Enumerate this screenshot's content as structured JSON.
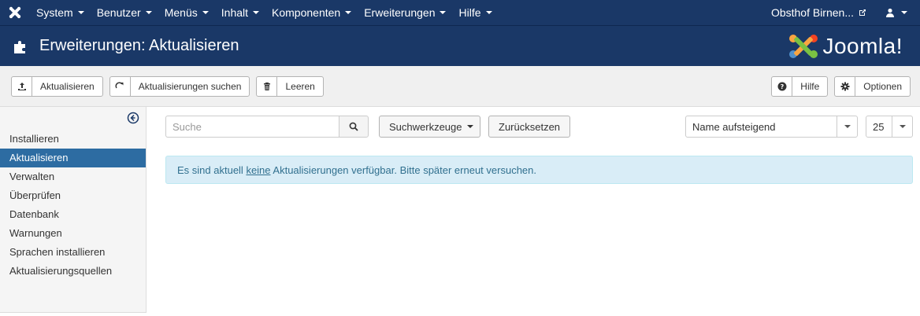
{
  "nav": {
    "items": [
      {
        "label": "System"
      },
      {
        "label": "Benutzer"
      },
      {
        "label": "Menüs"
      },
      {
        "label": "Inhalt"
      },
      {
        "label": "Komponenten"
      },
      {
        "label": "Erweiterungen"
      },
      {
        "label": "Hilfe"
      }
    ],
    "site_name": "Obsthof Birnen..."
  },
  "header": {
    "title": "Erweiterungen: Aktualisieren",
    "brand": "Joomla!"
  },
  "toolbar": {
    "update_label": "Aktualisieren",
    "find_updates_label": "Aktualisierungen suchen",
    "clear_label": "Leeren",
    "help_label": "Hilfe",
    "options_label": "Optionen"
  },
  "sidebar": {
    "items": [
      {
        "label": "Installieren"
      },
      {
        "label": "Aktualisieren",
        "active": true
      },
      {
        "label": "Verwalten"
      },
      {
        "label": "Überprüfen"
      },
      {
        "label": "Datenbank"
      },
      {
        "label": "Warnungen"
      },
      {
        "label": "Sprachen installieren"
      },
      {
        "label": "Aktualisierungsquellen"
      }
    ]
  },
  "filters": {
    "search_placeholder": "Suche",
    "search_tools_label": "Suchwerkzeuge",
    "reset_label": "Zurücksetzen",
    "ordering_value": "Name aufsteigend",
    "limit_value": "25"
  },
  "alert": {
    "prefix": "Es sind aktuell ",
    "emphasis": "keine",
    "suffix": " Aktualisierungen verfügbar. Bitte später erneut versuchen."
  },
  "colors": {
    "navbar": "#1a3867",
    "sidebar_active": "#2d6ca2",
    "alert_bg": "#d9edf7",
    "alert_text": "#31708f"
  }
}
